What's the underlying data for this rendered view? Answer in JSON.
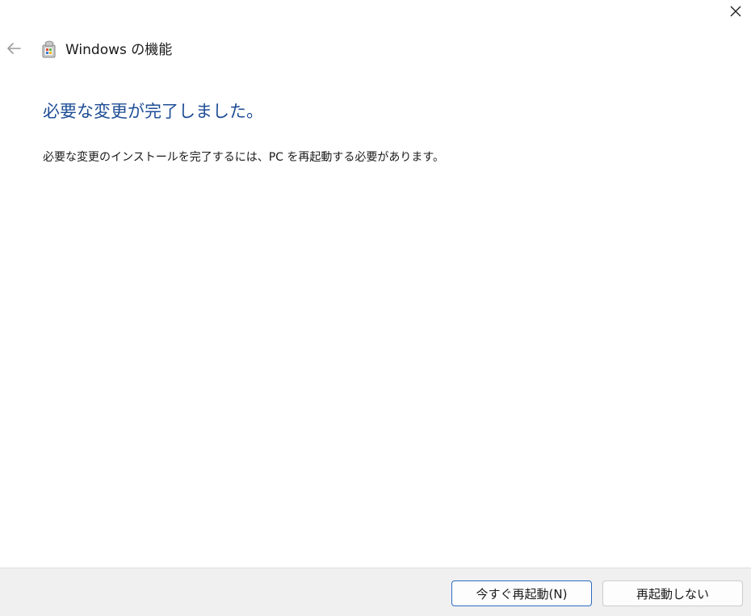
{
  "window": {
    "title": "Windows の機能",
    "app_icon": "windows-features-icon",
    "back_icon": "back-arrow-icon",
    "close_icon": "close-icon"
  },
  "content": {
    "heading": "必要な変更が完了しました。",
    "message": "必要な変更のインストールを完了するには、PC を再起動する必要があります。"
  },
  "footer": {
    "restart_now_label": "今すぐ再起動(N)",
    "dont_restart_label": "再起動しない"
  },
  "colors": {
    "heading": "#1f4e96",
    "primary_button_border": "#2e6bc6",
    "footer_background": "#f0f0f0"
  }
}
